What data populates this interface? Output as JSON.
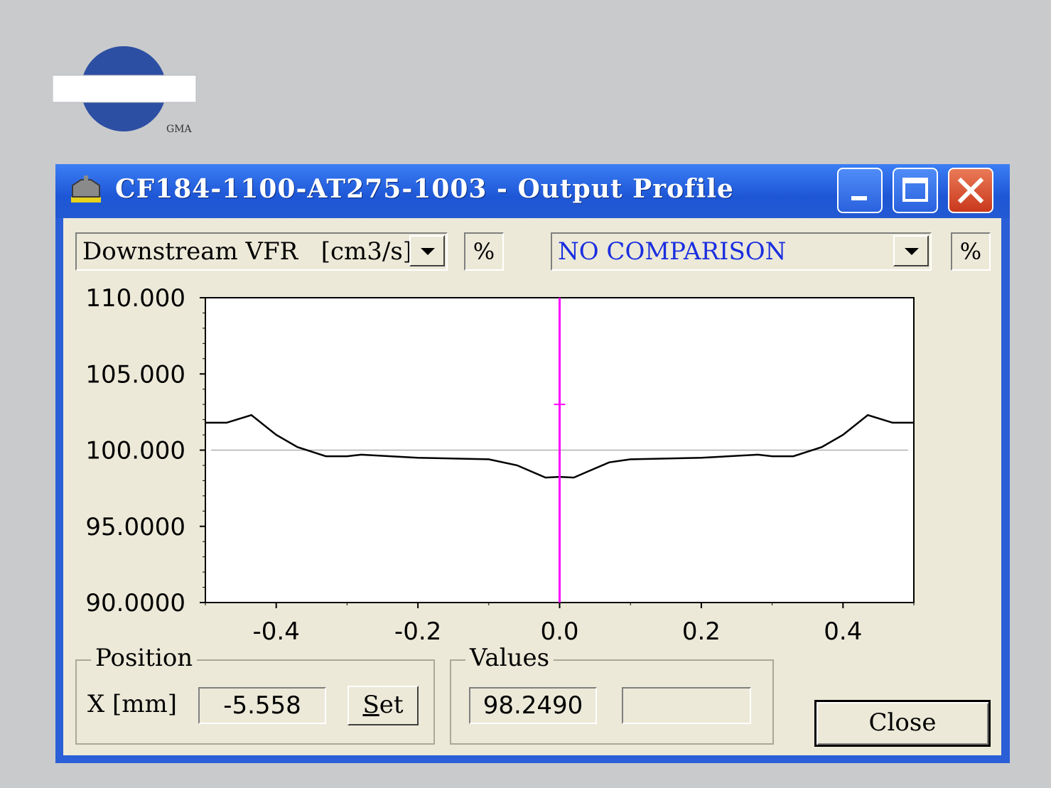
{
  "logo": {
    "text": "GMA"
  },
  "window": {
    "title": "CF184-1100-AT275-1003 - Output Profile"
  },
  "toolbar": {
    "quantity_selected": "Downstream VFR   [cm3/s]",
    "percent_label_left": "%",
    "comparison_selected": "NO COMPARISON",
    "comparison_color": "#1a2ee0",
    "percent_label_right": "%"
  },
  "chart_data": {
    "type": "line",
    "x": [
      -0.5,
      -0.47,
      -0.435,
      -0.4,
      -0.37,
      -0.33,
      -0.3,
      -0.28,
      -0.2,
      -0.1,
      -0.06,
      -0.04,
      -0.02,
      0.0,
      0.02,
      0.04,
      0.07,
      0.1,
      0.2,
      0.28,
      0.3,
      0.33,
      0.37,
      0.4,
      0.435,
      0.47,
      0.5
    ],
    "series": [
      {
        "values": [
          101.8,
          101.8,
          102.3,
          101.0,
          100.2,
          99.6,
          99.6,
          99.7,
          99.5,
          99.4,
          99.0,
          98.6,
          98.2,
          98.249,
          98.2,
          98.6,
          99.2,
          99.4,
          99.5,
          99.7,
          99.6,
          99.6,
          100.2,
          101.0,
          102.3,
          101.8,
          101.8
        ],
        "color": "#000000"
      }
    ],
    "reference_line": {
      "y": 100.0,
      "color": "#b0b0b0"
    },
    "cursor": {
      "x": 0.0,
      "color": "#ff00ff",
      "marker_y": 103.0
    },
    "xlim": [
      -0.5,
      0.5
    ],
    "ylim": [
      90.0,
      110.0
    ],
    "xticks": [
      -0.4,
      -0.2,
      0.0,
      0.2,
      0.4
    ],
    "xtick_labels": [
      "-0.4",
      "-0.2",
      "0.0",
      "0.2",
      "0.4"
    ],
    "yticks": [
      90.0,
      95.0,
      100.0,
      105.0,
      110.0
    ],
    "ytick_labels": [
      "90.0000",
      "95.0000",
      "100.000",
      "105.000",
      "110.000"
    ],
    "grid": false
  },
  "position": {
    "group_label": "Position",
    "x_label": "X [mm]",
    "x_value": "-5.558",
    "set_label": "Set"
  },
  "values": {
    "group_label": "Values",
    "value_1": "98.2490",
    "value_2": ""
  },
  "close_label": "Close"
}
